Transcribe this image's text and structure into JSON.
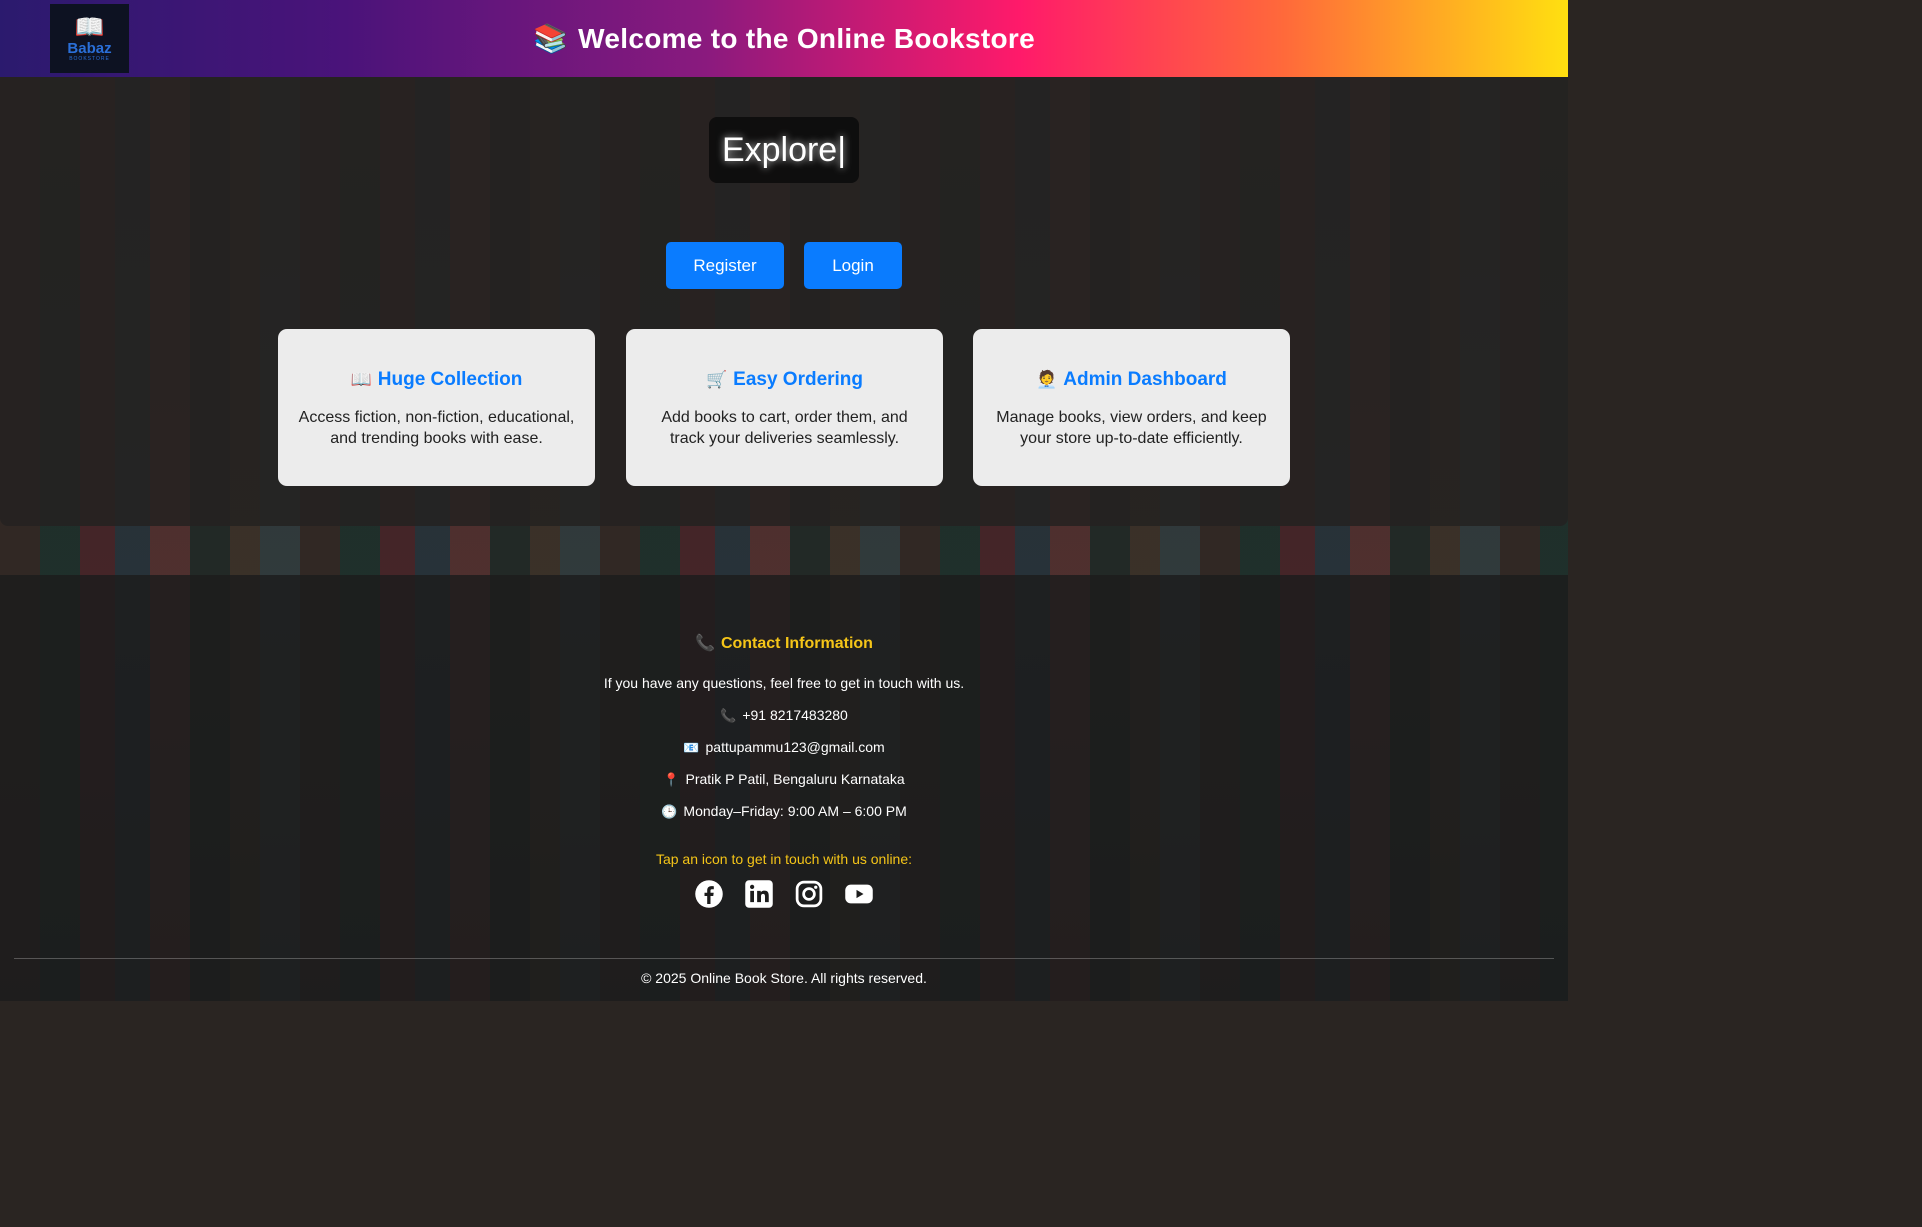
{
  "header": {
    "logo": {
      "icon": "book-cart-icon",
      "name": "Babaz",
      "sub": "BOOKSTORE"
    },
    "title_icon": "📚",
    "title": "Welcome to the Online Bookstore"
  },
  "hero": {
    "typing_text": "Explore|",
    "buttons": {
      "register": "Register",
      "login": "Login"
    },
    "cards": [
      {
        "icon": "📖",
        "title": "Huge Collection",
        "text": "Access fiction, non-fiction, educational, and trending books with ease."
      },
      {
        "icon": "🛒",
        "title": "Easy Ordering",
        "text": "Add books to cart, order them, and track your deliveries seamlessly."
      },
      {
        "icon": "🧑‍💼",
        "title": "Admin Dashboard",
        "text": "Manage books, view orders, and keep your store up-to-date efficiently."
      }
    ]
  },
  "footer": {
    "contact_icon": "📞",
    "contact_title": "Contact Information",
    "intro": "If you have any questions, feel free to get in touch with us.",
    "phone_icon": "📞",
    "phone": "+91 8217483280",
    "email_icon": "📧",
    "email": "pattupammu123@gmail.com",
    "address_icon": "📍",
    "address": "Pratik P Patil, Bengaluru Karnataka",
    "hours_icon": "🕒",
    "hours": "Monday–Friday: 9:00 AM – 6:00 PM",
    "tap_text": "Tap an icon to get in touch with us online:",
    "socials": [
      "facebook-icon",
      "linkedin-icon",
      "instagram-icon",
      "youtube-icon"
    ],
    "copyright": "© 2025 Online Book Store. All rights reserved."
  },
  "colors": {
    "accent_blue": "#0a7cff",
    "contact_yellow": "#f5c518",
    "card_bg": "#ececec"
  }
}
